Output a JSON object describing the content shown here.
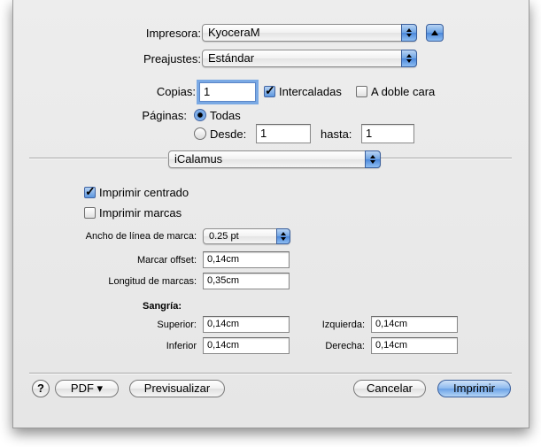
{
  "printer": {
    "label": "Impresora:",
    "value": "KyoceraM"
  },
  "presets": {
    "label": "Preajustes:",
    "value": "Estándar"
  },
  "copies": {
    "label": "Copias:",
    "value": "1",
    "collated_label": "Intercaladas",
    "collated": true,
    "duplex_label": "A doble cara",
    "duplex": false
  },
  "pages": {
    "label": "Páginas:",
    "all_label": "Todas",
    "from_label": "Desde:",
    "from_value": "1",
    "to_label": "hasta:",
    "to_value": "1",
    "selected": "all"
  },
  "panel_selector": {
    "value": "iCalamus"
  },
  "icalamus": {
    "print_centered_label": "Imprimir centrado",
    "print_centered": true,
    "print_marks_label": "Imprimir marcas",
    "print_marks": false,
    "mark_width_label": "Ancho de línea de marca:",
    "mark_width_value": "0.25 pt",
    "mark_offset_label": "Marcar offset:",
    "mark_offset_value": "0,14cm",
    "mark_length_label": "Longitud de marcas:",
    "mark_length_value": "0,35cm",
    "bleed_heading": "Sangría:",
    "top_label": "Superior:",
    "top_value": "0,14cm",
    "bottom_label": "Inferior",
    "bottom_value": "0,14cm",
    "left_label": "Izquierda:",
    "left_value": "0,14cm",
    "right_label": "Derecha:",
    "right_value": "0,14cm"
  },
  "footer": {
    "help_label": "?",
    "pdf_label": "PDF ▾",
    "preview_label": "Previsualizar",
    "cancel_label": "Cancelar",
    "print_label": "Imprimir"
  },
  "colors": {
    "accent": "#6aa1e6",
    "sheet_bg": "#e8e8e8"
  }
}
